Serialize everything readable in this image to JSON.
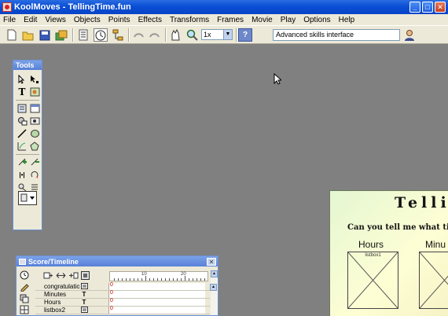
{
  "window": {
    "title": "KoolMoves - TellingTime.fun"
  },
  "menu": [
    "File",
    "Edit",
    "Views",
    "Objects",
    "Points",
    "Effects",
    "Transforms",
    "Frames",
    "Movie",
    "Play",
    "Options",
    "Help"
  ],
  "toolbar": {
    "zoom_value": "1x",
    "interface_mode": "Advanced skills interface"
  },
  "tools_panel": {
    "title": "Tools"
  },
  "score_timeline": {
    "title": "Score/Timeline",
    "ruler_labels": [
      "10",
      "20"
    ],
    "layers": [
      {
        "name": "congratulation",
        "type_icon": "listbox-icon",
        "first_frame": "0"
      },
      {
        "name": "Minutes",
        "type_icon": "text-icon",
        "type_glyph": "T",
        "first_frame": "0"
      },
      {
        "name": "Hours",
        "type_icon": "text-icon",
        "type_glyph": "T",
        "first_frame": "0"
      },
      {
        "name": "listbox2",
        "type_icon": "listbox-icon",
        "first_frame": "0"
      }
    ]
  },
  "stage": {
    "title": "Telli",
    "question": "Can you tell me what time",
    "hours_label": "Hours",
    "minutes_label": "Minu",
    "listbox1_label": "listbox1"
  },
  "colors": {
    "titlebar": "#0a4fd6",
    "chrome": "#ece9d8",
    "workspace": "#808080",
    "stage_bg": "#fefed4"
  }
}
